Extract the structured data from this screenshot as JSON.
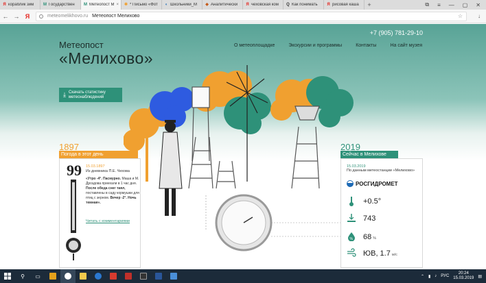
{
  "browser": {
    "tabs": [
      {
        "label": "кораблик зим",
        "fav": "Я",
        "fav_color": "#e52620"
      },
      {
        "label": "Государствен",
        "fav": "M",
        "fav_color": "#2e9179"
      },
      {
        "label": "Метеопост M",
        "fav": "M",
        "fav_color": "#2e9179",
        "active": true
      },
      {
        "label": "* Письмо «Фот",
        "fav": "✱",
        "fav_color": "#f0a030"
      },
      {
        "label": "Школьники_M",
        "fav": "◐",
        "fav_color": "#1d6ab5"
      },
      {
        "label": "Аналитически",
        "fav": "◆",
        "fav_color": "#c45a1a"
      },
      {
        "label": "чеховская ком",
        "fav": "Я",
        "fav_color": "#e52620"
      },
      {
        "label": "Как понимать",
        "fav": "Q",
        "fav_color": "#333333"
      },
      {
        "label": "рисовая каша",
        "fav": "Я",
        "fav_color": "#e52620"
      }
    ],
    "back_icon": "←",
    "forward_icon": "→",
    "yandex_icon": "Я",
    "domain": "meteomelikhovo.ru",
    "page_title": "Метеопост Мелихово",
    "bookmark_icon": "☆",
    "download_icon": "↓"
  },
  "site": {
    "phone": "+7 (905) 781-29-10",
    "logo_line1": "Метеопост",
    "logo_line2": "«Мелихово»",
    "menu": [
      "О метеоплощадке",
      "Экскурсии и программы",
      "Контакты",
      "На сайт музея"
    ],
    "download_button": "Скачать статистику метеонаблюдений",
    "history": {
      "year": "1897",
      "heading": "Погода в этот день",
      "quote_mark": "99",
      "date": "15.03.1897",
      "source": "Из дневника П.Е. Чехова",
      "text_part1": "«Утро -4°. Пасмурно.",
      "text_part2": " Маша и М. Дроздова приехали в 1 час дня.",
      "text_part3": " После обеда снег таял,",
      "text_part4": " поставлены в саду кормушки для птиц с зерном.",
      "text_part5": " Вечер -2°. Ночь темная».",
      "link": "Читать с комментариями"
    },
    "current": {
      "year": "2019",
      "heading": "Сейчас в Мелихове",
      "date": "15.03.2019",
      "source": "По данным метеостанции «Мелихово»",
      "provider": "РОСГИДРОМЕТ",
      "temperature": "+0.5°",
      "pressure": "743",
      "humidity": "68",
      "humidity_unit": "%",
      "wind": "ЮВ, 1.7",
      "wind_unit": "м/с"
    }
  },
  "taskbar": {
    "lang": "РУС",
    "time": "20:24",
    "date": "15.03.2019"
  },
  "colors": {
    "teal": "#2e9179",
    "orange": "#f0a030",
    "blue": "#2e5be0"
  }
}
